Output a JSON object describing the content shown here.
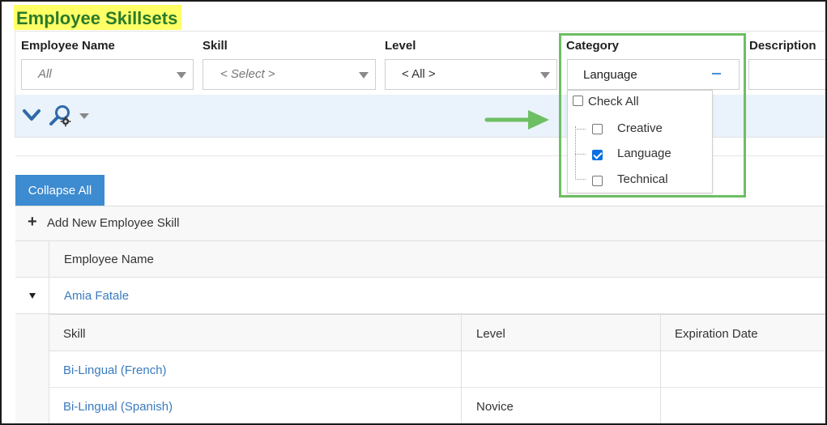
{
  "page": {
    "title": "Employee Skillsets"
  },
  "filters": {
    "employee_name": {
      "label": "Employee Name",
      "value": "All"
    },
    "skill": {
      "label": "Skill",
      "value": "< Select >"
    },
    "level": {
      "label": "Level",
      "value": "< All >"
    },
    "category": {
      "label": "Category",
      "value": "Language"
    },
    "description": {
      "label": "Description",
      "value": ""
    }
  },
  "toolbar": {
    "expand_icon": "chevron-down-icon",
    "search_icon": "search-settings-icon"
  },
  "category_dropdown": {
    "check_all_label": "Check All",
    "check_all_checked": false,
    "items": [
      {
        "label": "Creative",
        "checked": false
      },
      {
        "label": "Language",
        "checked": true
      },
      {
        "label": "Technical",
        "checked": false
      }
    ]
  },
  "grid": {
    "collapse_all_label": "Collapse All",
    "add_new_label": "Add New Employee Skill",
    "column_employee_name": "Employee Name",
    "employee": {
      "name": "Amia Fatale",
      "sub_columns": {
        "skill": "Skill",
        "level": "Level",
        "expiration_date": "Expiration Date"
      },
      "skills": [
        {
          "skill": "Bi-Lingual (French)",
          "level": "",
          "expiration_date": ""
        },
        {
          "skill": "Bi-Lingual (Spanish)",
          "level": "Novice",
          "expiration_date": ""
        }
      ]
    }
  },
  "colors": {
    "accent": "#3d8bd0",
    "highlight_border": "#6dbf63",
    "title_bg": "#ffff66",
    "title_fg": "#2a7a2a",
    "link": "#3a7bbf"
  }
}
